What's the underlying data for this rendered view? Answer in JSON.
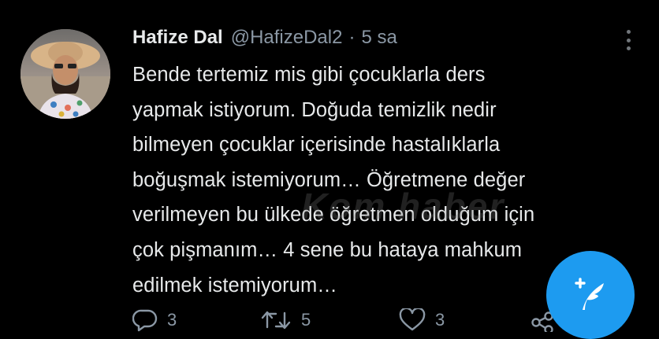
{
  "tweet": {
    "author": {
      "display_name": "Hafize Dal",
      "handle": "@HafizeDal2",
      "separator": "·",
      "time": "5 sa"
    },
    "text_lines": [
      "Bende tertemiz mis gibi çocuklarla ders",
      "yapmak istiyorum. Doğuda temizlik nedir",
      "bilmeyen çocuklar içerisinde hastalıklarla",
      "boğuşmak istemiyorum… Öğretmene değer",
      "verilmeyen bu ülkede öğretmen olduğum için",
      "çok pişmanım… 4 sene bu hataya mahkum",
      "edilmek istemiyorum…"
    ],
    "actions": {
      "reply_count": "3",
      "retweet_count": "5",
      "like_count": "3"
    }
  },
  "watermark": "Kom haber",
  "icons": {
    "reply": "reply-icon",
    "retweet": "retweet-icon",
    "like": "heart-icon",
    "share": "share-icon",
    "more": "more-vertical-icon",
    "compose": "compose-tweet-icon"
  },
  "colors": {
    "background": "#000000",
    "text": "#e7e9ea",
    "secondary": "#8b98a5",
    "accent": "#1d9bf0"
  }
}
